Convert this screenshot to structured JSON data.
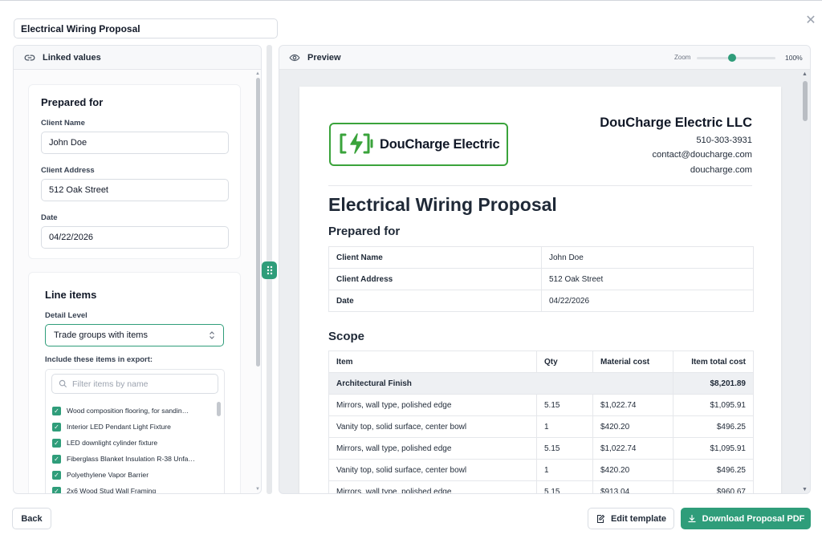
{
  "window": {
    "title_value": "Electrical Wiring Proposal",
    "close_glyph": "✕"
  },
  "left_panel": {
    "header_label": "Linked values",
    "prepared_for": {
      "title": "Prepared for",
      "client_name_label": "Client Name",
      "client_name_value": "John Doe",
      "client_address_label": "Client Address",
      "client_address_value": "512 Oak Street",
      "date_label": "Date",
      "date_value": "04/22/2026"
    },
    "line_items": {
      "title": "Line items",
      "detail_level_label": "Detail Level",
      "detail_level_value": "Trade groups with items",
      "include_label": "Include these items in export:",
      "filter_placeholder": "Filter items by name",
      "items": [
        {
          "label": "Wood composition flooring, for sandin…",
          "checked": true
        },
        {
          "label": "Interior LED Pendant Light Fixture",
          "checked": true
        },
        {
          "label": "LED downlight cylinder fixture",
          "checked": true
        },
        {
          "label": "Fiberglass Blanket Insulation R-38 Unfa…",
          "checked": true
        },
        {
          "label": "Polyethylene Vapor Barrier",
          "checked": true
        },
        {
          "label": "2x6 Wood Stud Wall Framing",
          "checked": true
        }
      ]
    }
  },
  "preview": {
    "header_label": "Preview",
    "zoom_label": "Zoom",
    "zoom_value": "100%",
    "zoom_fraction": 0.45,
    "document": {
      "logo_text": "DouCharge Electric",
      "company_name": "DouCharge Electric LLC",
      "phone": "510-303-3931",
      "email": "contact@doucharge.com",
      "website": "doucharge.com",
      "title": "Electrical Wiring Proposal",
      "prepared_for_heading": "Prepared for",
      "info_rows": [
        {
          "key": "Client Name",
          "value": "John Doe"
        },
        {
          "key": "Client Address",
          "value": "512 Oak Street"
        },
        {
          "key": "Date",
          "value": "04/22/2026"
        }
      ],
      "scope_heading": "Scope",
      "scope_columns": [
        "Item",
        "Qty",
        "Material cost",
        "Item total cost"
      ],
      "scope_group": {
        "name": "Architectural Finish",
        "total": "$8,201.89"
      },
      "scope_rows": [
        {
          "item": "Mirrors, wall type, polished edge",
          "qty": "5.15",
          "material": "$1,022.74",
          "total": "$1,095.91"
        },
        {
          "item": "Vanity top, solid surface, center bowl",
          "qty": "1",
          "material": "$420.20",
          "total": "$496.25"
        },
        {
          "item": "Mirrors, wall type, polished edge",
          "qty": "5.15",
          "material": "$1,022.74",
          "total": "$1,095.91"
        },
        {
          "item": "Vanity top, solid surface, center bowl",
          "qty": "1",
          "material": "$420.20",
          "total": "$496.25"
        },
        {
          "item": "Mirrors, wall type, polished edge",
          "qty": "5.15",
          "material": "$913.04",
          "total": "$960.67"
        }
      ]
    }
  },
  "footer": {
    "back_label": "Back",
    "edit_template_label": "Edit template",
    "download_label": "Download Proposal PDF"
  },
  "colors": {
    "accent": "#2f9d7a",
    "logo_green": "#3aa33b"
  },
  "icons": [
    "link-icon",
    "eye-icon",
    "search-icon",
    "checkmark-icon",
    "drag-handle-icon",
    "edit-icon",
    "download-icon",
    "close-icon",
    "battery-bolt-icon"
  ]
}
